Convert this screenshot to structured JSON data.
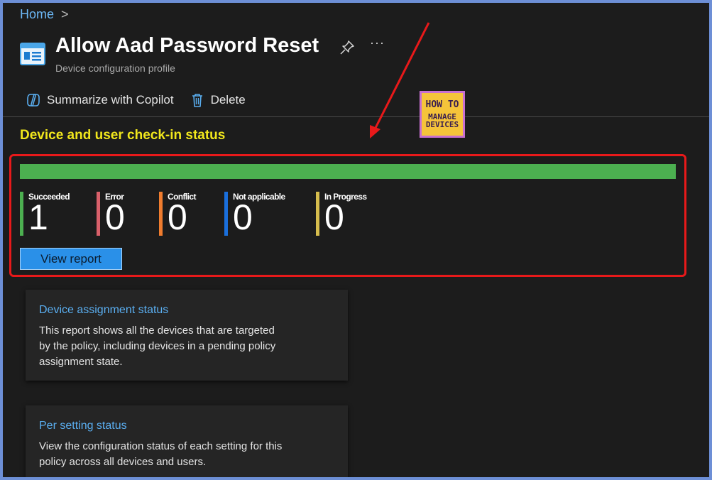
{
  "breadcrumb": {
    "home": "Home",
    "separator": ">"
  },
  "header": {
    "title": "Allow Aad Password Reset",
    "subtitle": "Device configuration profile",
    "more": "···"
  },
  "commands": {
    "summarize": "Summarize with Copilot",
    "delete": "Delete"
  },
  "section": {
    "title": "Device and user check-in status"
  },
  "logo": {
    "line1": "HOW TO",
    "line2": "MANAGE",
    "line3": "DEVICES"
  },
  "progress": {
    "succeeded_fraction": 1.0,
    "color": "#4caf50"
  },
  "stats": [
    {
      "label": "Succeeded",
      "value": "1",
      "color": "#4caf50"
    },
    {
      "label": "Error",
      "value": "0",
      "color": "#d9606a"
    },
    {
      "label": "Conflict",
      "value": "0",
      "color": "#f07c2e"
    },
    {
      "label": "Not applicable",
      "value": "0",
      "color": "#1a6fdc"
    },
    {
      "label": "In Progress",
      "value": "0",
      "color": "#d6bd4d"
    }
  ],
  "view_report": "View report",
  "cards": [
    {
      "title": "Device assignment status",
      "body": "This report shows all the devices that are targeted by the policy, including devices in a pending policy assignment state."
    },
    {
      "title": "Per setting status",
      "body": "View the configuration status of each setting for this policy across all devices and users."
    }
  ],
  "colors": {
    "accent": "#2a90e8",
    "section_title": "#f1e71c",
    "highlight_border": "#e8191a"
  }
}
